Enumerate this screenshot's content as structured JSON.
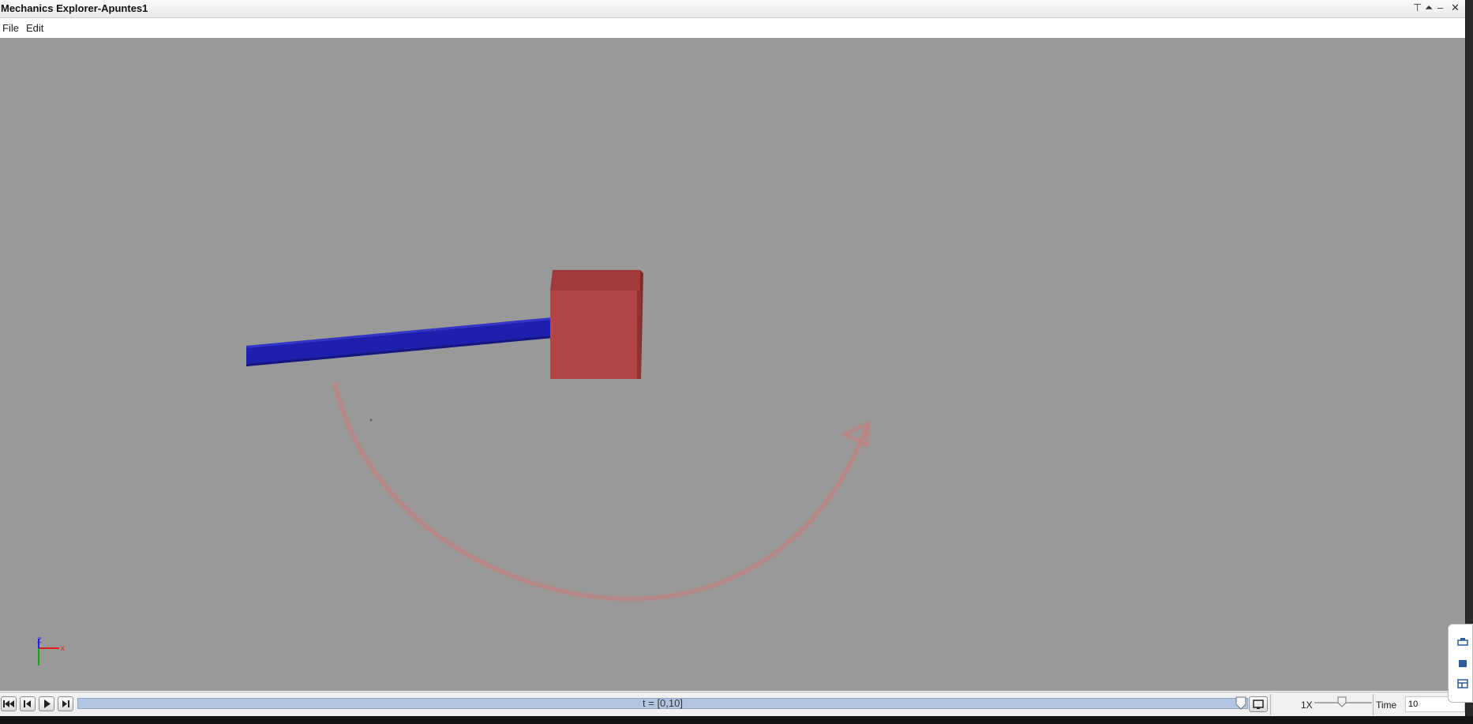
{
  "window": {
    "title": "Mechanics Explorer-Apuntes1"
  },
  "window_controls": {
    "pin": "⊤",
    "undock": "⏶",
    "minimize": "–",
    "close": "✕"
  },
  "menu": {
    "file": "File",
    "edit": "Edit"
  },
  "scene": {
    "background_color": "#999999",
    "rod_color": "#1f1fae",
    "block_color": "#b34545",
    "arrow_color": "#c77d7d"
  },
  "axes": {
    "x_label": "x",
    "z_label": "Z",
    "x_color": "#e02020",
    "z_color": "#2020e0",
    "y_color": "#20a020"
  },
  "playback": {
    "buttons": [
      "skip-to-start-icon",
      "step-back-icon",
      "play-icon",
      "step-forward-icon"
    ],
    "timeline_label": "t = [0,10]",
    "speed_label": "1X",
    "time_label": "Time",
    "time_value": "10"
  }
}
